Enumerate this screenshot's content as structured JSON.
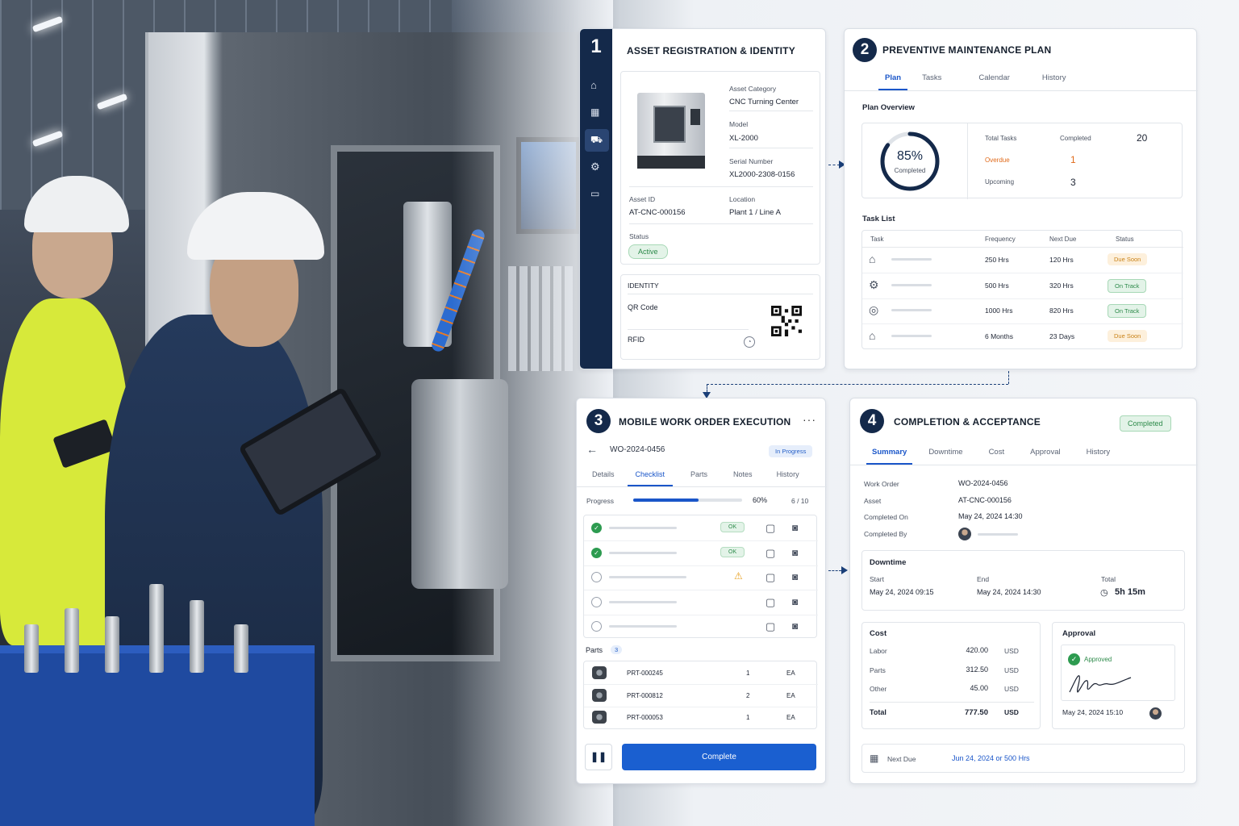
{
  "panel1": {
    "number": "1",
    "title": "ASSET REGISTRATION & IDENTITY",
    "nav_icons": [
      "home-icon",
      "building-icon",
      "asset-icon",
      "gear-icon",
      "monitor-icon"
    ],
    "fields": {
      "asset_category_label": "Asset Category",
      "asset_category": "CNC Turning Center",
      "model_label": "Model",
      "model": "XL-2000",
      "serial_label": "Serial Number",
      "serial": "XL2000-2308-0156",
      "asset_id_label": "Asset ID",
      "asset_id": "AT-CNC-000156",
      "location_label": "Location",
      "location": "Plant 1 / Line A",
      "status_label": "Status",
      "status": "Active"
    },
    "identity": {
      "heading": "IDENTITY",
      "qr_label": "QR Code",
      "rfid_label": "RFID"
    }
  },
  "panel2": {
    "number": "2",
    "title": "PREVENTIVE MAINTENANCE PLAN",
    "tabs": [
      "Plan",
      "Tasks",
      "Calendar",
      "History"
    ],
    "overview_heading": "Plan Overview",
    "progress_percent": 85,
    "progress_label": "85%",
    "progress_caption": "Completed",
    "stats": {
      "total_label": "Total Tasks",
      "completed_label": "Completed",
      "completed": "20",
      "overdue_label": "Overdue",
      "overdue": "1",
      "upcoming_label": "Upcoming",
      "upcoming": "3"
    },
    "task_list_heading": "Task List",
    "columns": [
      "Task",
      "Frequency",
      "Next Due",
      "Status"
    ],
    "rows": [
      {
        "icon": "machine-icon",
        "frequency": "250 Hrs",
        "next_due": "120 Hrs",
        "status": "Due Soon"
      },
      {
        "icon": "gear-icon",
        "frequency": "500 Hrs",
        "next_due": "320 Hrs",
        "status": "On Track"
      },
      {
        "icon": "filter-icon",
        "frequency": "1000 Hrs",
        "next_due": "820 Hrs",
        "status": "On Track"
      },
      {
        "icon": "machine-icon",
        "frequency": "6 Months",
        "next_due": "23 Days",
        "status": "Due Soon"
      }
    ]
  },
  "panel3": {
    "number": "3",
    "title": "MOBILE WORK ORDER EXECUTION",
    "work_order": "WO-2024-0456",
    "wo_status": "In Progress",
    "tabs": [
      "Details",
      "Checklist",
      "Parts",
      "Notes",
      "History"
    ],
    "progress_label": "Progress",
    "progress_percent": 60,
    "progress_text": "60%",
    "progress_count": "6 / 10",
    "checklist": [
      {
        "state": "done",
        "badge": "OK"
      },
      {
        "state": "done",
        "badge": "OK"
      },
      {
        "state": "warning",
        "badge": ""
      },
      {
        "state": "open",
        "badge": ""
      },
      {
        "state": "open",
        "badge": ""
      }
    ],
    "parts_label": "Parts",
    "parts_count": "3",
    "parts": [
      {
        "part": "PRT-000245",
        "qty": "1",
        "unit": "EA"
      },
      {
        "part": "PRT-000812",
        "qty": "2",
        "unit": "EA"
      },
      {
        "part": "PRT-000053",
        "qty": "1",
        "unit": "EA"
      }
    ],
    "complete_label": "Complete"
  },
  "panel4": {
    "number": "4",
    "title": "COMPLETION & ACCEPTANCE",
    "badge": "Completed",
    "tabs": [
      "Summary",
      "Downtime",
      "Cost",
      "Approval",
      "History"
    ],
    "summary": {
      "wo_label": "Work Order",
      "wo": "WO-2024-0456",
      "asset_label": "Asset",
      "asset": "AT-CNC-000156",
      "completed_on_label": "Completed On",
      "completed_on": "May 24, 2024  14:30",
      "completed_by_label": "Completed By"
    },
    "downtime": {
      "heading": "Downtime",
      "start_label": "Start",
      "start": "May 24, 2024 09:15",
      "end_label": "End",
      "end": "May 24, 2024  14:30",
      "total_label": "Total",
      "total": "5h 15m"
    },
    "cost": {
      "heading": "Cost",
      "rows": [
        {
          "label": "Labor",
          "value": "420.00",
          "currency": "USD"
        },
        {
          "label": "Parts",
          "value": "312.50",
          "currency": "USD"
        },
        {
          "label": "Other",
          "value": "45.00",
          "currency": "USD"
        }
      ],
      "total_label": "Total",
      "total": "777.50",
      "total_currency": "USD"
    },
    "approval": {
      "heading": "Approval",
      "status": "Approved",
      "date": "May 24, 2024  15:10"
    },
    "next_due_label": "Next Due",
    "next_due": "Jun 24, 2024 or 500 Hrs"
  },
  "colors": {
    "navy": "#14294a",
    "accent": "#1a56c9",
    "ok": "#2d9b50",
    "amber": "#e8a020",
    "overdue": "#e06a1a"
  }
}
